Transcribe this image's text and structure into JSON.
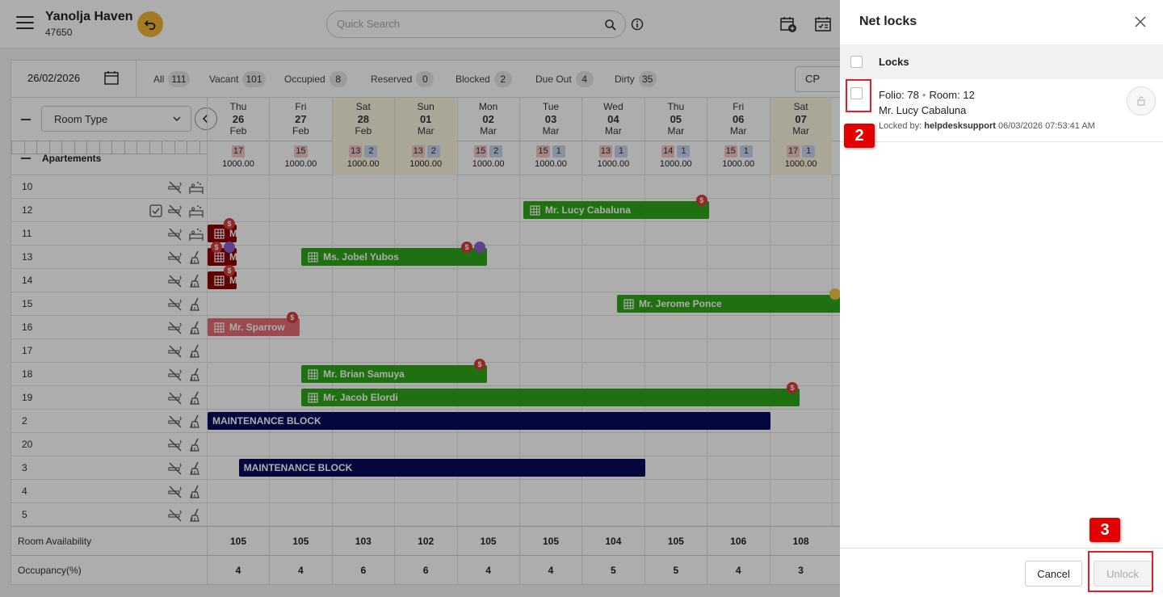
{
  "header": {
    "hotel_name": "Yanolja Haven",
    "hotel_id": "47650",
    "search_placeholder": "Quick Search"
  },
  "filterbar": {
    "date": "26/02/2026",
    "chips": [
      {
        "label": "All",
        "count": "111"
      },
      {
        "label": "Vacant",
        "count": "101"
      },
      {
        "label": "Occupied",
        "count": "8"
      },
      {
        "label": "Reserved",
        "count": "0"
      },
      {
        "label": "Blocked",
        "count": "2"
      },
      {
        "label": "Due Out",
        "count": "4"
      },
      {
        "label": "Dirty",
        "count": "35"
      }
    ],
    "rate_select": "CP"
  },
  "grid": {
    "room_type_label": "Room Type",
    "section_label": "Apartements",
    "days": [
      {
        "dow": "Thu",
        "day": "26",
        "mon": "Feb",
        "weekend": false,
        "avail": "17",
        "blocked": "",
        "rate": "1000.00"
      },
      {
        "dow": "Fri",
        "day": "27",
        "mon": "Feb",
        "weekend": false,
        "avail": "15",
        "blocked": "",
        "rate": "1000.00"
      },
      {
        "dow": "Sat",
        "day": "28",
        "mon": "Feb",
        "weekend": true,
        "avail": "13",
        "blocked": "2",
        "rate": "1000.00"
      },
      {
        "dow": "Sun",
        "day": "01",
        "mon": "Mar",
        "weekend": true,
        "avail": "13",
        "blocked": "2",
        "rate": "1000.00"
      },
      {
        "dow": "Mon",
        "day": "02",
        "mon": "Mar",
        "weekend": false,
        "avail": "15",
        "blocked": "2",
        "rate": "1000.00"
      },
      {
        "dow": "Tue",
        "day": "03",
        "mon": "Mar",
        "weekend": false,
        "avail": "15",
        "blocked": "1",
        "rate": "1000.00"
      },
      {
        "dow": "Wed",
        "day": "04",
        "mon": "Mar",
        "weekend": false,
        "avail": "13",
        "blocked": "1",
        "rate": "1000.00"
      },
      {
        "dow": "Thu",
        "day": "05",
        "mon": "Mar",
        "weekend": false,
        "avail": "14",
        "blocked": "1",
        "rate": "1000.00"
      },
      {
        "dow": "Fri",
        "day": "06",
        "mon": "Mar",
        "weekend": false,
        "avail": "15",
        "blocked": "1",
        "rate": "1000.00"
      },
      {
        "dow": "Sat",
        "day": "07",
        "mon": "Mar",
        "weekend": true,
        "avail": "17",
        "blocked": "1",
        "rate": "1000.00"
      }
    ],
    "rooms": [
      {
        "num": "10",
        "check": false,
        "icon2": "bed"
      },
      {
        "num": "12",
        "check": true,
        "icon2": "bed"
      },
      {
        "num": "11",
        "check": false,
        "icon2": "bed"
      },
      {
        "num": "13",
        "check": false,
        "icon2": "broom"
      },
      {
        "num": "14",
        "check": false,
        "icon2": "broom"
      },
      {
        "num": "15",
        "check": false,
        "icon2": "broom"
      },
      {
        "num": "16",
        "check": false,
        "icon2": "broom"
      },
      {
        "num": "17",
        "check": false,
        "icon2": "broom"
      },
      {
        "num": "18",
        "check": false,
        "icon2": "broom"
      },
      {
        "num": "19",
        "check": false,
        "icon2": "broom"
      },
      {
        "num": "2",
        "check": false,
        "icon2": "broom"
      },
      {
        "num": "20",
        "check": false,
        "icon2": "broom"
      },
      {
        "num": "3",
        "check": false,
        "icon2": "broom"
      },
      {
        "num": "4",
        "check": false,
        "icon2": "broom"
      },
      {
        "num": "5",
        "check": false,
        "icon2": "broom"
      }
    ],
    "bookings": [
      {
        "row": 1,
        "start": 5.05,
        "span": 2.97,
        "kind": "green",
        "name": "Mr. Lucy Cabaluna",
        "marks": [
          "dollar"
        ]
      },
      {
        "row": 2,
        "start": 0.0,
        "span": 0.47,
        "kind": "maroon",
        "name": "M",
        "marks": [
          "dollar"
        ]
      },
      {
        "row": 3,
        "start": 0.0,
        "span": 0.47,
        "kind": "maroon",
        "name": "M",
        "marks": [
          "dollar",
          "person"
        ]
      },
      {
        "row": 3,
        "start": 1.5,
        "span": 2.97,
        "kind": "green",
        "name": "Ms. Jobel Yubos",
        "marks": [
          "dollar",
          "person"
        ]
      },
      {
        "row": 4,
        "start": 0.0,
        "span": 0.47,
        "kind": "maroon",
        "name": "M",
        "marks": [
          "dollar"
        ]
      },
      {
        "row": 5,
        "start": 6.55,
        "span": 3.6,
        "kind": "green",
        "name": "Mr. Jerome Ponce",
        "marks": [
          "crown"
        ]
      },
      {
        "row": 6,
        "start": 0.0,
        "span": 1.47,
        "kind": "pink",
        "name": "Mr. Sparrow",
        "marks": [
          "dollar"
        ]
      },
      {
        "row": 8,
        "start": 1.5,
        "span": 2.97,
        "kind": "green",
        "name": "Mr. Brian Samuya",
        "marks": [
          "dollar"
        ]
      },
      {
        "row": 9,
        "start": 1.5,
        "span": 7.97,
        "kind": "green",
        "name": "Mr. Jacob Elordi",
        "marks": [
          "dollar"
        ]
      },
      {
        "row": 10,
        "start": 0.0,
        "span": 9.0,
        "kind": "navy",
        "name": "MAINTENANCE BLOCK",
        "marks": []
      },
      {
        "row": 12,
        "start": 0.5,
        "span": 6.5,
        "kind": "navy",
        "name": "MAINTENANCE BLOCK",
        "marks": []
      }
    ],
    "availability_label": "Room Availability",
    "availability": [
      "105",
      "105",
      "103",
      "102",
      "105",
      "105",
      "104",
      "105",
      "106",
      "108"
    ],
    "occupancy_label": "Occupancy(%)",
    "occupancy": [
      "4",
      "4",
      "6",
      "6",
      "4",
      "4",
      "5",
      "5",
      "4",
      "3"
    ]
  },
  "panel": {
    "title": "Net locks",
    "locks_header": "Locks",
    "lock_item": {
      "folio": "Folio: 78",
      "room": "Room: 12",
      "guest": "Mr. Lucy Cabaluna",
      "locked_by_label": "Locked by:",
      "locked_by_user": "helpdesksupport",
      "locked_at": "06/03/2026 07:53:41 AM"
    },
    "cancel_label": "Cancel",
    "unlock_label": "Unlock"
  },
  "annotations": {
    "step2": "2",
    "step3": "3"
  },
  "colors": {
    "green_booking": "#2ea518",
    "navy_block": "#060a5c",
    "pink_booking": "#e46c78",
    "maroon_booking": "#8e0000",
    "accent_back": "#f2b634",
    "annotation_red": "#e30000"
  }
}
